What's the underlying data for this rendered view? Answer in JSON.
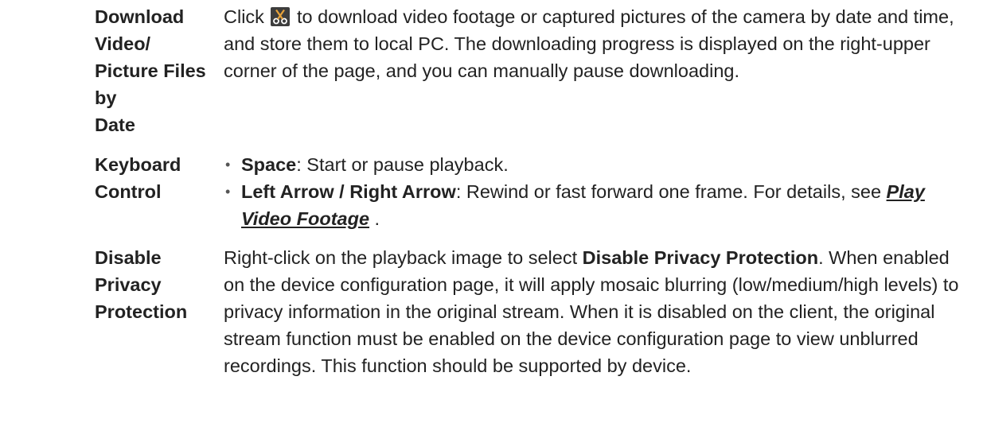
{
  "rows": [
    {
      "term": "Download Video/\nPicture Files by\nDate",
      "desc_before_icon": "Click ",
      "icon": "scissors-icon",
      "desc_after_icon": " to download video footage or captured pictures of the camera by date and time, and store them to local PC. The downloading progress is displayed on the right-upper corner of the page, and you can manually pause downloading."
    },
    {
      "term": "Keyboard Control",
      "bullets": [
        {
          "key": "Space",
          "text": ": Start or pause playback."
        },
        {
          "key": "Left Arrow / Right Arrow",
          "text": ": Rewind or fast forward one frame. For details, see ",
          "link": "Play Video Footage",
          "after_link": " ."
        }
      ]
    },
    {
      "term": "Disable Privacy\nProtection",
      "desc_before_bold": "Right-click on the playback image to select ",
      "bold": "Disable Privacy Protection",
      "desc_after_bold": ". When enabled on the device configuration page, it will apply mosaic blurring (low/medium/high levels) to privacy information in the original stream. When it is disabled on the client, the original stream function must be enabled on the device configuration page to view unblurred recordings. This function should be supported by device."
    }
  ]
}
